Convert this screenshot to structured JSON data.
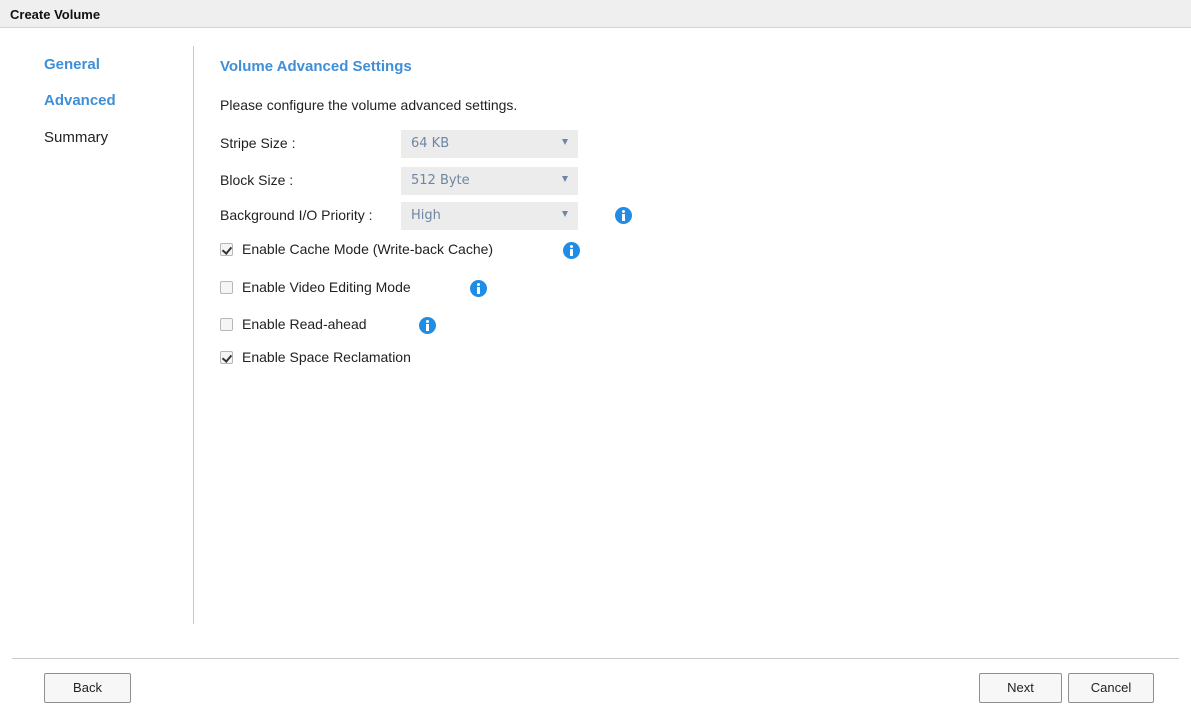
{
  "window": {
    "title": "Create Volume"
  },
  "nav": {
    "items": [
      {
        "label": "General",
        "state": "done"
      },
      {
        "label": "Advanced",
        "state": "current"
      },
      {
        "label": "Summary",
        "state": "todo"
      }
    ]
  },
  "main": {
    "section_title": "Volume Advanced Settings",
    "intro": "Please configure the volume advanced settings.",
    "stripe_size": {
      "label": "Stripe Size :",
      "value": "64 KB"
    },
    "block_size": {
      "label": "Block Size :",
      "value": "512 Byte"
    },
    "io_priority": {
      "label": "Background I/O Priority :",
      "value": "High",
      "info_icon": "info-icon"
    },
    "options": [
      {
        "label": "Enable Cache Mode (Write-back Cache)",
        "checked": true,
        "info_icon": "info-icon"
      },
      {
        "label": "Enable Video Editing Mode",
        "checked": false,
        "info_icon": "info-icon"
      },
      {
        "label": "Enable Read-ahead",
        "checked": false,
        "info_icon": "info-icon"
      },
      {
        "label": "Enable Space Reclamation",
        "checked": true
      }
    ]
  },
  "footer": {
    "back_label": "Back",
    "next_label": "Next",
    "cancel_label": "Cancel"
  },
  "colors": {
    "accent": "#3f8fd8",
    "info_icon": "#1f8ce6",
    "select_bg": "#ececec",
    "select_text": "#6f86a3"
  }
}
